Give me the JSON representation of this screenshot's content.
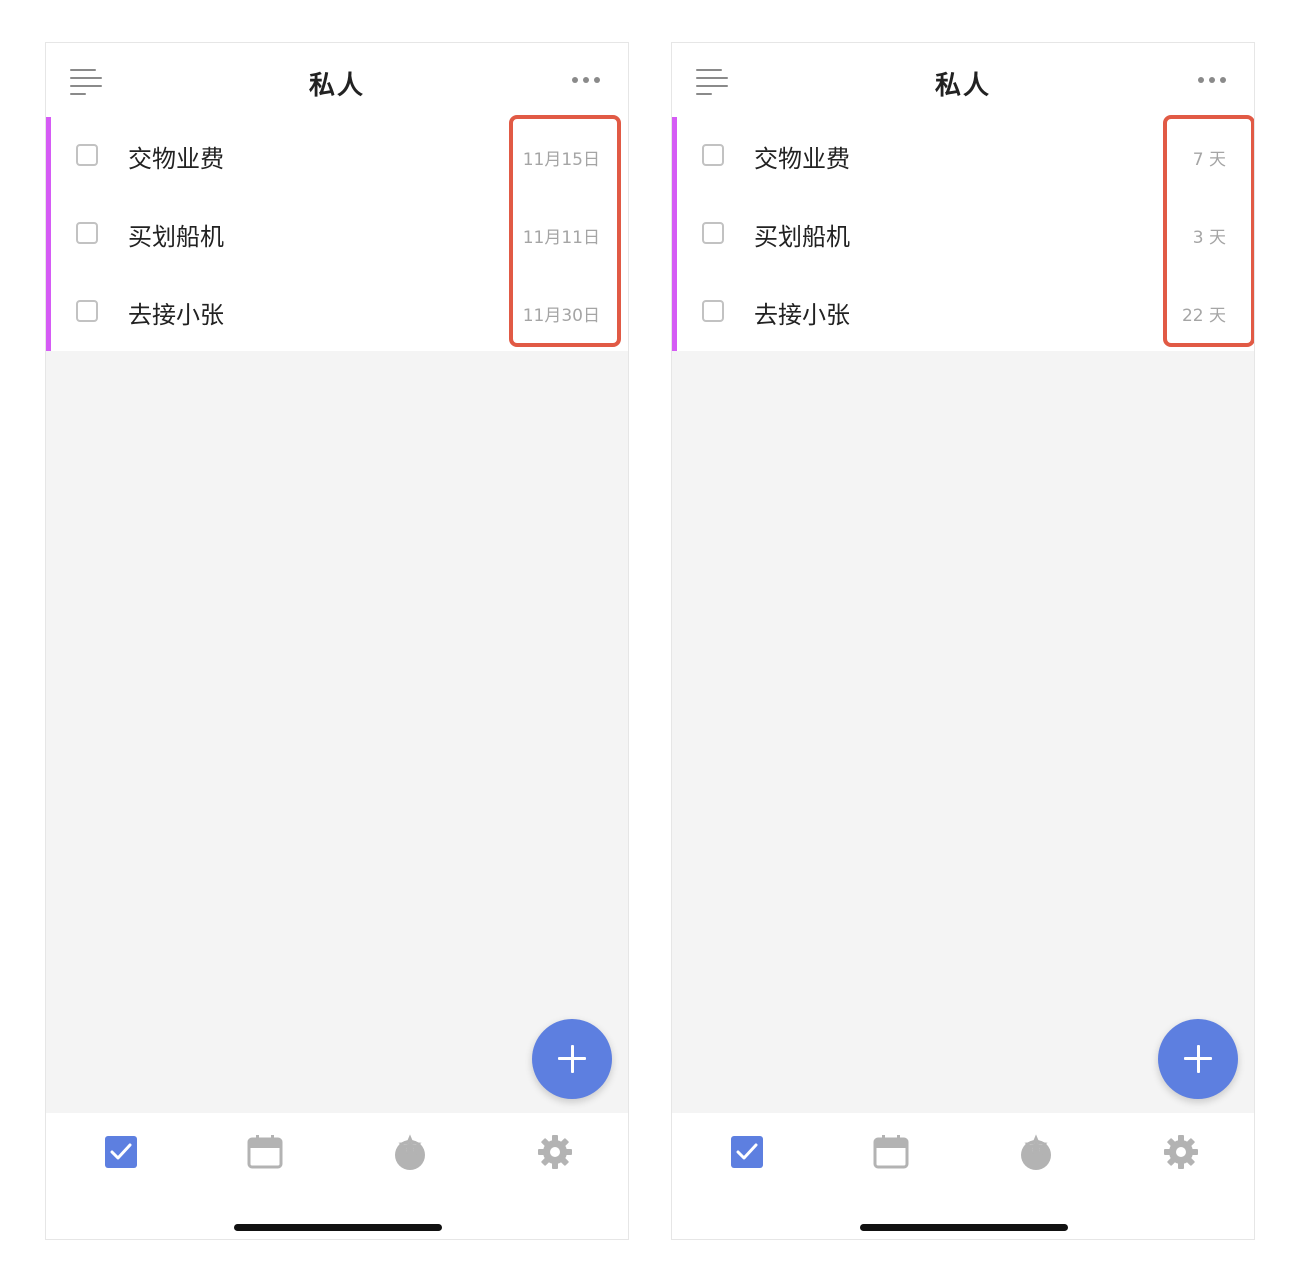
{
  "colors": {
    "accent": "#5d7fe0",
    "list_accent": "#d55bf5",
    "highlight_box": "#e15a45",
    "icon_gray": "#b3b3b3"
  },
  "screens": [
    {
      "header": {
        "title": "私人",
        "menu_icon": "menu-lines-icon",
        "more_icon": "more-dots-icon"
      },
      "tasks": [
        {
          "name": "交物业费",
          "due": "11月15日"
        },
        {
          "name": "买划船机",
          "due": "11月11日"
        },
        {
          "name": "去接小张",
          "due": "11月30日"
        }
      ],
      "fab_icon": "plus-icon",
      "tabs": [
        "check-icon",
        "calendar-icon",
        "tomato-icon",
        "gear-icon"
      ],
      "active_tab": "check-icon"
    },
    {
      "header": {
        "title": "私人",
        "menu_icon": "menu-lines-icon",
        "more_icon": "more-dots-icon"
      },
      "tasks": [
        {
          "name": "交物业费",
          "due": "7 天"
        },
        {
          "name": "买划船机",
          "due": "3 天"
        },
        {
          "name": "去接小张",
          "due": "22 天"
        }
      ],
      "fab_icon": "plus-icon",
      "tabs": [
        "check-icon",
        "calendar-icon",
        "tomato-icon",
        "gear-icon"
      ],
      "active_tab": "check-icon"
    }
  ]
}
